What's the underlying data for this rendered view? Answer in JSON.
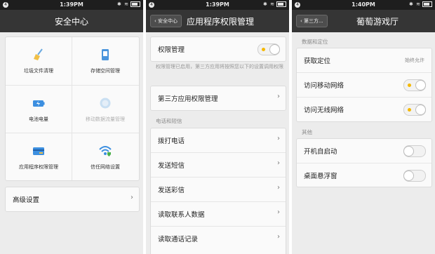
{
  "status": {
    "time1": "1:39PM",
    "time2": "1:39PM",
    "time3": "1:40PM",
    "badge": "4",
    "icons": "✱ ≋"
  },
  "screen1": {
    "title": "安全中心",
    "tiles": [
      {
        "label": "垃圾文件清理",
        "icon": "broom-icon"
      },
      {
        "label": "存储空间管理",
        "icon": "storage-icon"
      },
      {
        "label": "电池电量",
        "icon": "battery-icon"
      },
      {
        "label": "移动数据流量管理",
        "icon": "data-usage-icon"
      },
      {
        "label": "应用程序权限管理",
        "icon": "permission-card-icon"
      },
      {
        "label": "信任网络设置",
        "icon": "wifi-shield-icon"
      }
    ],
    "advanced": "高级设置"
  },
  "screen2": {
    "back": "安全中心",
    "title": "应用程序权限管理",
    "perm_label": "权限管理",
    "perm_on": true,
    "perm_desc": "权限管理已启用，第三方应用将按照您以下的设置调用权限",
    "third_party": "第三方应用权限管理",
    "section": "电话和短信",
    "items": [
      "拨打电话",
      "发送短信",
      "发送彩信",
      "读取联系人数据",
      "读取通话记录"
    ]
  },
  "screen3": {
    "back": "第三方...",
    "title": "葡萄游戏厅",
    "section1": "数据和定位",
    "location_label": "获取定位",
    "location_value": "始终允许",
    "mobile_net": "访问移动网络",
    "mobile_on": true,
    "wifi_net": "访问无线网络",
    "wifi_on": true,
    "section2": "其他",
    "autostart": "开机自启动",
    "autostart_on": false,
    "float_window": "桌面悬浮窗",
    "float_on": false
  },
  "colors": {
    "accent": "#f5b800",
    "titlebar": "#353535",
    "background": "#ececec"
  }
}
